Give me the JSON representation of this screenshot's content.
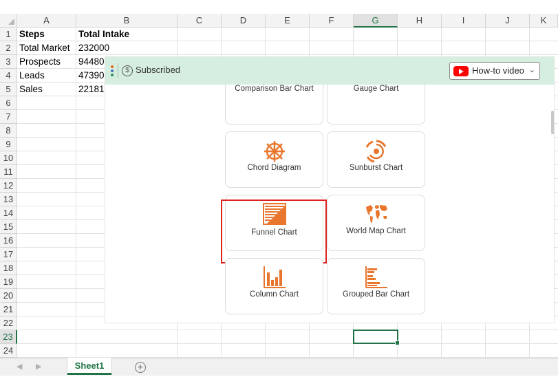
{
  "columns": [
    "A",
    "B",
    "C",
    "D",
    "E",
    "F",
    "G",
    "H",
    "I",
    "J",
    "K"
  ],
  "rows": [
    "1",
    "2",
    "3",
    "4",
    "5",
    "6",
    "7",
    "8",
    "9",
    "10",
    "11",
    "12",
    "13",
    "14",
    "15",
    "16",
    "17",
    "18",
    "19",
    "20",
    "21",
    "22",
    "23",
    "24"
  ],
  "selected_column": "G",
  "selected_row": "23",
  "cells": {
    "A1": "Steps",
    "B1": "Total Intake",
    "A2": "Total Market",
    "B2": "232000",
    "A3": "Prospects",
    "B3": "94480",
    "A4": "Leads",
    "B4": "47390",
    "A5": "Sales",
    "B5": "22181"
  },
  "panel": {
    "subscribed_label": "Subscribed",
    "subscribed_icon": "dollar-circle-icon",
    "howto_label": "How-to video",
    "howto_icon": "youtube-icon",
    "charts": [
      {
        "label": "Comparison Bar Chart",
        "icon": "comparison-bar-chart-icon"
      },
      {
        "label": "Gauge Chart",
        "icon": "gauge-chart-icon"
      },
      {
        "label": "Chord Diagram",
        "icon": "chord-diagram-icon"
      },
      {
        "label": "Sunburst Chart",
        "icon": "sunburst-chart-icon"
      },
      {
        "label": "Funnel Chart",
        "icon": "funnel-chart-icon"
      },
      {
        "label": "World Map Chart",
        "icon": "world-map-chart-icon"
      },
      {
        "label": "Column Chart",
        "icon": "column-chart-icon"
      },
      {
        "label": "Grouped Bar Chart",
        "icon": "grouped-bar-chart-icon"
      }
    ],
    "highlighted_chart": "Funnel Chart",
    "accent_color": "#e8762d",
    "bar_color": "#d5eee0"
  },
  "sheet_tabs": [
    {
      "label": "Sheet1",
      "active": true
    }
  ],
  "excel_green": "#217346"
}
